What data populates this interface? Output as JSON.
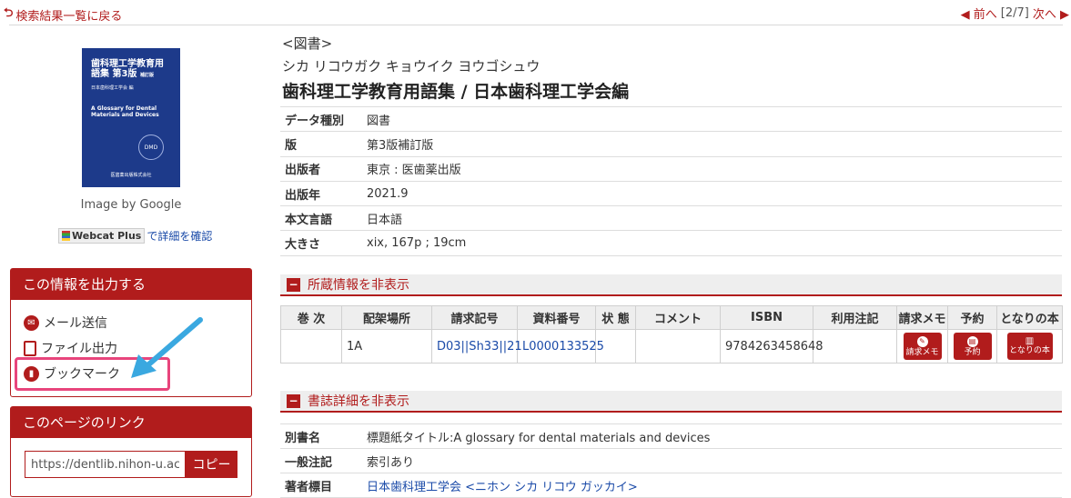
{
  "nav": {
    "back": "検索結果一覧に戻る",
    "prev": "前へ",
    "position": "[2/7]",
    "next": "次へ"
  },
  "cover": {
    "title_jp": "歯科理工学教育用語集",
    "edition": "第3版",
    "edition_note": "補訂版",
    "editor": "日本歯科理工学会 編",
    "title_en": "A Glossary for Dental Materials and Devices",
    "logo": "DMD",
    "publisher": "医歯薬出版株式会社"
  },
  "image_by": "Image by Google",
  "webcat": {
    "badge": "Webcat Plus",
    "link": "で詳細を確認"
  },
  "output_panel": {
    "title": "この情報を出力する",
    "items": [
      "メール送信",
      "ファイル出力",
      "ブックマーク"
    ]
  },
  "link_panel": {
    "title": "このページのリンク",
    "url": "https://dentlib.nihon-u.ac",
    "copy": "コピー"
  },
  "record": {
    "type_label": "<図書>",
    "kana": "シカ リコウガク キョウイク ヨウゴシュウ",
    "title": "歯科理工学教育用語集 / 日本歯科理工学会編",
    "fields": [
      {
        "label": "データ種別",
        "value": "図書"
      },
      {
        "label": "版",
        "value": "第3版補訂版"
      },
      {
        "label": "出版者",
        "value": "東京 : 医歯薬出版"
      },
      {
        "label": "出版年",
        "value": "2021.9"
      },
      {
        "label": "本文言語",
        "value": "日本語"
      },
      {
        "label": "大きさ",
        "value": "xix, 167p ; 19cm"
      }
    ]
  },
  "holdings": {
    "section_title": "所蔵情報を非表示",
    "headers": [
      "巻 次",
      "配架場所",
      "請求記号",
      "資料番号",
      "状 態",
      "コメント",
      "ISBN",
      "利用注記",
      "請求メモ",
      "予約",
      "となりの本"
    ],
    "row": {
      "volume": "",
      "location": "1A",
      "call_number": "D03||Sh33||21",
      "material_id": "L0000133525",
      "status": "",
      "comment": "",
      "isbn": "9784263458648",
      "note": "",
      "memo_btn": "請求メモ",
      "reserve_btn": "予約",
      "neighbor_btn": "となりの本"
    }
  },
  "bib": {
    "section_title": "書誌詳細を非表示",
    "fields": [
      {
        "label": "別書名",
        "value": "標題紙タイトル:A glossary for dental materials and devices"
      },
      {
        "label": "一般注記",
        "value": "索引あり"
      },
      {
        "label": "著者標目",
        "value": "日本歯科理工学会 <ニホン シカ リコウ ガッカイ>"
      }
    ]
  },
  "colors": {
    "accent": "#b11c1c",
    "link": "#1a4aa8",
    "highlight": "#e8457c",
    "arrow": "#3aa8e0"
  }
}
